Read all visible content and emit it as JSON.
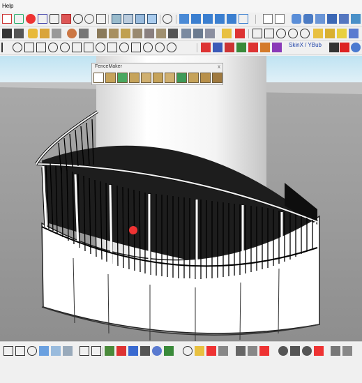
{
  "menubar": {
    "help_label": "Help"
  },
  "toolbar": {
    "extension_label": "SkinX / YBub"
  },
  "fencemaker": {
    "title": "FenceMaker",
    "close_glyph": "x"
  }
}
